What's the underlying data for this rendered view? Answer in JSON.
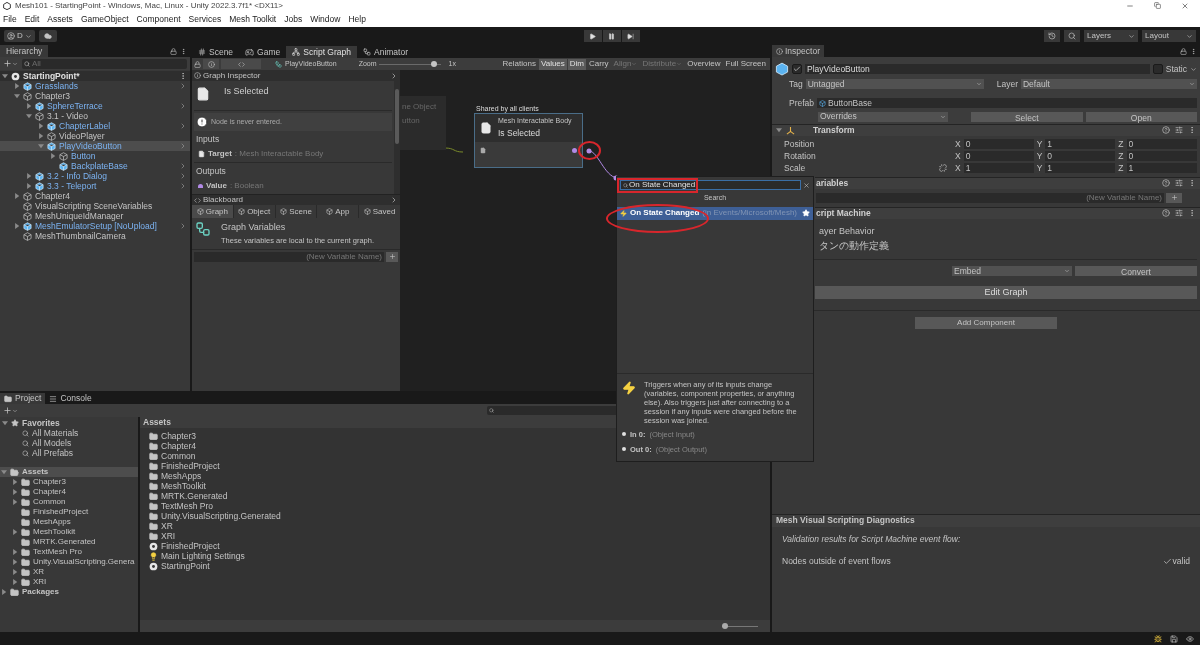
{
  "window": {
    "title": "Mesh101 - StartingPoint - Windows, Mac, Linux - Unity 2022.3.7f1* <DX11>"
  },
  "menu": [
    "File",
    "Edit",
    "Assets",
    "GameObject",
    "Component",
    "Services",
    "Mesh Toolkit",
    "Jobs",
    "Window",
    "Help"
  ],
  "toolbar": {
    "account": "D",
    "layers": "Layers",
    "layout": "Layout"
  },
  "hierarchy": {
    "title": "Hierarchy",
    "search_placeholder": "All",
    "items": [
      {
        "name": "StartingPoint*",
        "kind": "scene",
        "expanded": true,
        "selected": false,
        "children": [
          {
            "name": "Grasslands",
            "kind": "prefab",
            "expanded": false,
            "selected": false
          },
          {
            "name": "Chapter3",
            "kind": "object",
            "expanded": true,
            "selected": false,
            "children": [
              {
                "name": "SphereTerrace",
                "kind": "prefab",
                "expanded": false,
                "selected": false
              },
              {
                "name": "3.1 - Video",
                "kind": "object",
                "expanded": true,
                "selected": false,
                "children": [
                  {
                    "name": "ChapterLabel",
                    "kind": "prefab",
                    "expanded": false,
                    "selected": false
                  },
                  {
                    "name": "VideoPlayer",
                    "kind": "object",
                    "expanded": false,
                    "selected": false
                  },
                  {
                    "name": "PlayVideoButton",
                    "kind": "prefab",
                    "expanded": true,
                    "selected": true,
                    "children": [
                      {
                        "name": "Button",
                        "kind": "prefab-part",
                        "expanded": false,
                        "selected": false
                      },
                      {
                        "name": "BackplateBase",
                        "kind": "prefab",
                        "selected": false
                      }
                    ]
                  }
                ]
              },
              {
                "name": "3.2 - Info Dialog",
                "kind": "prefab",
                "expanded": false,
                "selected": false
              },
              {
                "name": "3.3 - Teleport",
                "kind": "prefab",
                "expanded": false,
                "selected": false
              }
            ]
          },
          {
            "name": "Chapter4",
            "kind": "object",
            "expanded": false,
            "selected": false
          },
          {
            "name": "VisualScripting SceneVariables",
            "kind": "object",
            "selected": false
          },
          {
            "name": "MeshUniqueIdManager",
            "kind": "object",
            "selected": false
          },
          {
            "name": "MeshEmulatorSetup [NoUpload]",
            "kind": "prefab",
            "expanded": false,
            "selected": false
          },
          {
            "name": "MeshThumbnailCamera",
            "kind": "object",
            "selected": false
          }
        ]
      }
    ]
  },
  "graph": {
    "tabs": [
      {
        "label": "Scene",
        "kind": "scene",
        "selected": false
      },
      {
        "label": "Game",
        "kind": "game",
        "selected": false
      },
      {
        "label": "Script Graph",
        "kind": "graph",
        "selected": true
      },
      {
        "label": "Animator",
        "kind": "animator",
        "selected": false
      }
    ],
    "graph_name": "PlayVideoButton",
    "zoom_label": "Zoom",
    "zoom": {
      "level": 0.9
    },
    "zoom_value": "1x",
    "tools": [
      {
        "label": "Relations",
        "on": false
      },
      {
        "label": "Values",
        "on": true
      },
      {
        "label": "Dim",
        "on": true
      },
      {
        "label": "Carry",
        "on": false
      },
      {
        "label": "Align",
        "on": false,
        "dropdown": true
      },
      {
        "label": "Distribute",
        "on": false,
        "dropdown": true
      },
      {
        "label": "Overview",
        "on": false
      },
      {
        "label": "Full Screen",
        "on": false
      }
    ],
    "inspector": {
      "title": "Graph Inspector",
      "node": "Is Selected",
      "warning": "Node is never entered.",
      "inputs_label": "Inputs",
      "inputs": [
        {
          "name": "Target",
          "type": ": Mesh Interactable Body"
        }
      ],
      "outputs_label": "Outputs",
      "outputs": [
        {
          "name": "Value",
          "type": ": Boolean"
        }
      ]
    },
    "blackboard": {
      "title": "Blackboard",
      "tabs": [
        {
          "label": "Graph",
          "selected": true
        },
        {
          "label": "Object",
          "selected": false
        },
        {
          "label": "Scene",
          "selected": false
        },
        {
          "label": "App",
          "selected": false
        },
        {
          "label": "Saved",
          "selected": false
        }
      ],
      "heading": "Graph Variables",
      "description": "These variables are local to the current graph.",
      "placeholder": "(New Variable Name)"
    },
    "canvas": {
      "partial_node": [
        "ne Object",
        "utton"
      ],
      "group_label": "Shared by all clients",
      "node": {
        "subtitle": "Mesh Interactable Body",
        "title": "Is Selected"
      }
    }
  },
  "fuzzy_finder": {
    "query": "On State Changed",
    "header": "Search",
    "results": [
      {
        "title": "On State Changed",
        "path": "(in Events/Microsoft/Mesh)",
        "selected": true
      }
    ],
    "description": "Triggers when any of its inputs change (variables, component properties, or anything else). Also triggers just after connecting to a session if any inputs were changed before the session was joined.",
    "ports": [
      {
        "name": "In 0:",
        "type": "(Object Input)"
      },
      {
        "name": "Out 0:",
        "type": "(Object Output)"
      }
    ]
  },
  "inspector": {
    "title": "Inspector",
    "object_name": "PlayVideoButton",
    "active": true,
    "static": false,
    "static_label": "Static",
    "tag_label": "Tag",
    "tag": "Untagged",
    "layer_label": "Layer",
    "layer": "Default",
    "prefab_label": "Prefab",
    "prefab": "ButtonBase",
    "overrides": "Overrides",
    "select": "Select",
    "open": "Open",
    "transform": {
      "title": "Transform",
      "expanded": true,
      "rows": [
        {
          "label": "Position",
          "axes": [
            "X",
            "Y",
            "Z"
          ],
          "values": [
            "0",
            "1",
            "0"
          ]
        },
        {
          "label": "Rotation",
          "axes": [
            "X",
            "Y",
            "Z"
          ],
          "values": [
            "0",
            "0",
            "0"
          ]
        },
        {
          "label": "Scale",
          "proportional": false,
          "axes": [
            "X",
            "Y",
            "Z"
          ],
          "values": [
            "1",
            "1",
            "1"
          ]
        }
      ]
    },
    "variables": {
      "title": "ariables",
      "placeholder": "(New Variable Name)"
    },
    "script_machine": {
      "title": "cript Machine",
      "graph_title": "ayer Behavior",
      "graph_summary": "タンの動作定義",
      "source": "Embed",
      "convert": "Convert",
      "edit": "Edit Graph"
    },
    "add_component": "Add Component",
    "diagnostics": {
      "title": "Mesh Visual Scripting Diagnostics",
      "subtitle": "Validation results for Script Machine event flow:",
      "checks": [
        {
          "label": "Nodes outside of event flows",
          "result": "valid",
          "passed": true
        }
      ]
    }
  },
  "project": {
    "tabs": [
      {
        "label": "Project",
        "kind": "project",
        "selected": true
      },
      {
        "label": "Console",
        "kind": "console",
        "selected": false
      }
    ],
    "favorites": {
      "label": "Favorites",
      "expanded": true,
      "items": [
        "All Materials",
        "All Models",
        "All Prefabs"
      ]
    },
    "tree": [
      {
        "name": "Assets",
        "kind": "folder-open",
        "expanded": true,
        "selected": true,
        "children": [
          {
            "name": "Chapter3",
            "kind": "folder",
            "expanded": false,
            "selected": false
          },
          {
            "name": "Chapter4",
            "kind": "folder",
            "expanded": false,
            "selected": false
          },
          {
            "name": "Common",
            "kind": "folder",
            "expanded": false,
            "selected": false
          },
          {
            "name": "FinishedProject",
            "kind": "folder",
            "selected": false
          },
          {
            "name": "MeshApps",
            "kind": "folder",
            "selected": false
          },
          {
            "name": "MeshToolkit",
            "kind": "folder",
            "expanded": false,
            "selected": false
          },
          {
            "name": "MRTK.Generated",
            "kind": "folder",
            "selected": false
          },
          {
            "name": "TextMesh Pro",
            "kind": "folder",
            "expanded": false,
            "selected": false
          },
          {
            "name": "Unity.VisualScripting.Genera",
            "kind": "folder",
            "expanded": false,
            "selected": false
          },
          {
            "name": "XR",
            "kind": "folder",
            "expanded": false,
            "selected": false
          },
          {
            "name": "XRI",
            "kind": "folder",
            "expanded": false,
            "selected": false
          }
        ]
      },
      {
        "name": "Packages",
        "kind": "folder",
        "expanded": false,
        "selected": false
      }
    ],
    "breadcrumb": "Assets",
    "assets": [
      {
        "name": "Chapter3",
        "kind": "folder"
      },
      {
        "name": "Chapter4",
        "kind": "folder"
      },
      {
        "name": "Common",
        "kind": "folder"
      },
      {
        "name": "FinishedProject",
        "kind": "folder"
      },
      {
        "name": "MeshApps",
        "kind": "folder"
      },
      {
        "name": "MeshToolkit",
        "kind": "folder"
      },
      {
        "name": "MRTK.Generated",
        "kind": "folder"
      },
      {
        "name": "TextMesh Pro",
        "kind": "folder"
      },
      {
        "name": "Unity.VisualScripting.Generated",
        "kind": "folder"
      },
      {
        "name": "XR",
        "kind": "folder"
      },
      {
        "name": "XRI",
        "kind": "folder"
      },
      {
        "name": "FinishedProject",
        "kind": "scene"
      },
      {
        "name": "Main Lighting Settings",
        "kind": "lighting"
      },
      {
        "name": "StartingPoint",
        "kind": "scene"
      }
    ],
    "icon_size": {
      "level": 0
    }
  }
}
